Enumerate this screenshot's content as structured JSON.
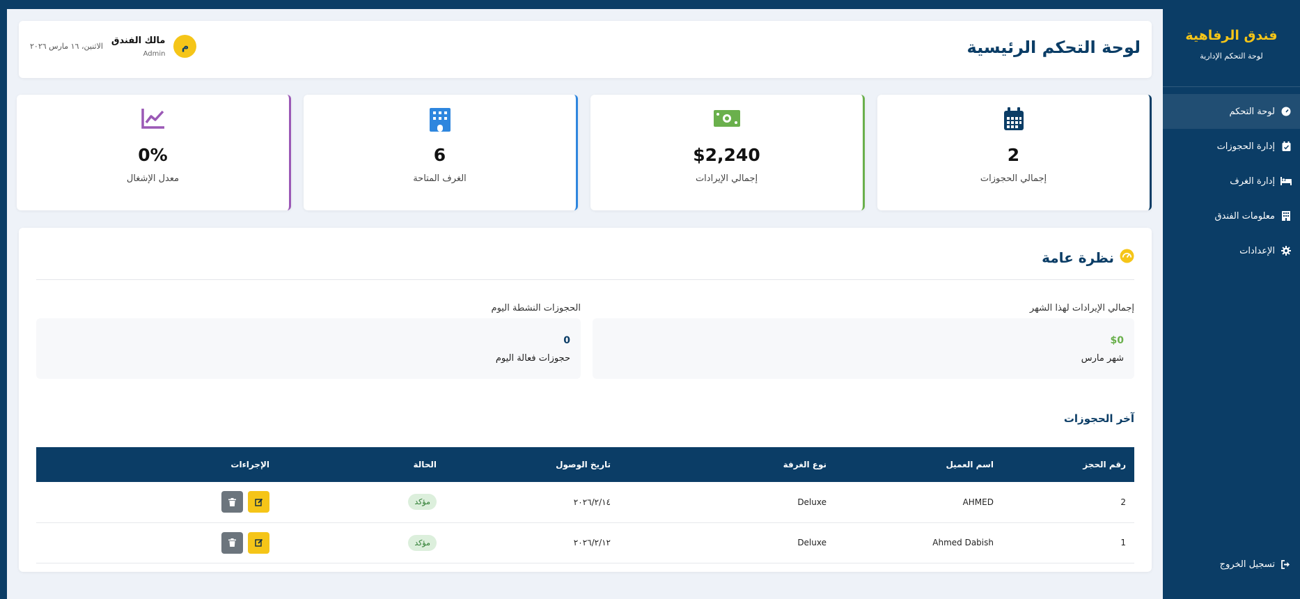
{
  "sidebar": {
    "brand_title": "فندق الرفاهية",
    "brand_sub": "لوحة التحكم الإدارية",
    "items": [
      {
        "label": "لوحة التحكم",
        "icon": "gauge-icon"
      },
      {
        "label": "إدارة الحجوزات",
        "icon": "calendar-check-icon"
      },
      {
        "label": "إدارة الغرف",
        "icon": "bed-icon"
      },
      {
        "label": "معلومات الفندق",
        "icon": "building-icon"
      },
      {
        "label": "الإعدادات",
        "icon": "gear-icon"
      }
    ],
    "logout_label": "تسجيل الخروج"
  },
  "header": {
    "title": "لوحة التحكم الرئيسية",
    "user_name": "مالك الفندق",
    "user_role": "Admin",
    "avatar_letter": "م",
    "date": "الاثنين، ١٦ مارس ٢٠٢٦"
  },
  "stats": [
    {
      "value": "2",
      "label": "إجمالي الحجوزات",
      "icon": "calendar-icon",
      "color": "#0b3d66"
    },
    {
      "value": "$2,240",
      "label": "إجمالي الإيرادات",
      "icon": "money-icon",
      "color": "#6ab04c"
    },
    {
      "value": "6",
      "label": "الغرف المتاحة",
      "icon": "hotel-icon",
      "color": "#2e86de"
    },
    {
      "value": "0%",
      "label": "معدل الإشغال",
      "icon": "chart-line-icon",
      "color": "#9b59b6"
    }
  ],
  "overview": {
    "title": "نظرة عامة",
    "revenue_label": "إجمالي الإيرادات لهذا الشهر",
    "revenue_value": "$0",
    "revenue_sub": "شهر مارس",
    "active_label": "الحجوزات النشطة اليوم",
    "active_value": "0",
    "active_sub": "حجوزات فعالة اليوم",
    "recent_title": "آخر الحجوزات"
  },
  "table": {
    "headers": [
      "رقم الحجز",
      "اسم العميل",
      "نوع الغرفة",
      "تاريخ الوصول",
      "الحالة",
      "الإجراءات"
    ],
    "rows": [
      {
        "id": "2",
        "name": "AHMED",
        "room": "Deluxe",
        "date": "٢٠٢٦/٢/١٤",
        "status": "مؤكد"
      },
      {
        "id": "1",
        "name": "Ahmed Dabish",
        "room": "Deluxe",
        "date": "٢٠٢٦/٢/١٢",
        "status": "مؤكد"
      }
    ]
  },
  "colors": {
    "primary": "#0b3d66",
    "accent": "#f5c518",
    "success_bg": "#dcefdc",
    "success_text": "#2e7d32"
  }
}
